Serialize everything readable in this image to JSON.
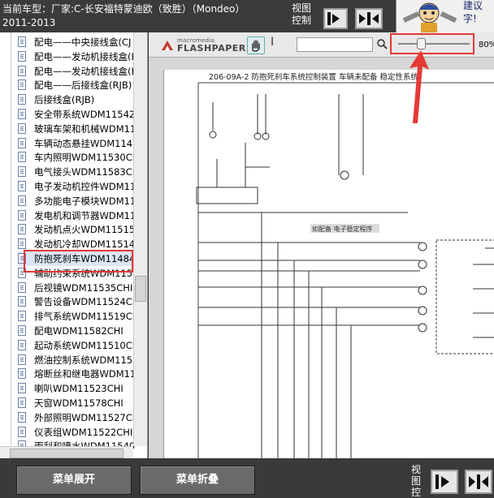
{
  "header": {
    "car_title": "当前车型：厂家:C-长安福特蒙迪欧（致胜）（Mondeo）",
    "year_range": "2011-2013",
    "view_control_label": "视图控制",
    "help_text_line1": "建议",
    "help_text_line2": "字!"
  },
  "sidebar": {
    "items": [
      {
        "label": "配电——中央接线盒(CJ"
      },
      {
        "label": "配电——发动机接线盒(E"
      },
      {
        "label": "配电——发动机接线盒(E"
      },
      {
        "label": "配电——后接线盒(RJB)"
      },
      {
        "label": "后接线盒(RJB)"
      },
      {
        "label": "安全带系统WDM11542"
      },
      {
        "label": "玻璃车架和机械WDM11"
      },
      {
        "label": "车辆动态悬挂WDM1148"
      },
      {
        "label": "车内照明WDM11530CH"
      },
      {
        "label": "电气接头WDM11583CH"
      },
      {
        "label": "电子发动机控件WDM11"
      },
      {
        "label": "多功能电子模块WDM11"
      },
      {
        "label": "发电机和调节器WDM11"
      },
      {
        "label": "发动机点火WDM11515"
      },
      {
        "label": "发动机冷却WDM11514"
      },
      {
        "label": "防抱死刹车WDM11484"
      },
      {
        "label": "辅助约束系统WDM1154"
      },
      {
        "label": "后视镜WDM11535CHI"
      },
      {
        "label": "警告设备WDM11524CH"
      },
      {
        "label": "排气系统WDM11519CH"
      },
      {
        "label": "配电WDM11582CHI"
      },
      {
        "label": "起动系统WDM11510CH"
      },
      {
        "label": "燃油控制系统WDM1151"
      },
      {
        "label": "熔断丝和继电器WDM11"
      },
      {
        "label": "喇叭WDM11523CHI"
      },
      {
        "label": "天窗WDM11578CHI"
      },
      {
        "label": "外部照明WDM11527CH"
      },
      {
        "label": "仪表组WDM11522CHI"
      },
      {
        "label": "雨刮和喷水WDM11540"
      }
    ],
    "selected_index": 15
  },
  "viewer": {
    "logo_small": "macromedia",
    "logo_big": "FLASHPAPER",
    "zoom_value": "80%",
    "zoom_level_fraction": 0.3,
    "doc_title": "206-09A-2 防抱死刹车系统控制装置 车辆未配备 稳定性系统",
    "doc_note": "如配备 电子稳定程序"
  },
  "bottom": {
    "expand_label": "菜单展开",
    "collapse_label": "菜单折叠",
    "view_control_label": "视图控"
  },
  "colors": {
    "background": "#3a3a3a",
    "annotation_red": "#e53935",
    "selected_row": "#dce6f5"
  },
  "icons": [
    "document-icon",
    "hand-tool-icon",
    "text-select-icon",
    "search-icon",
    "prev-page-icon",
    "fit-width-icon",
    "next-page-icon",
    "mechanic-mascot-icon"
  ]
}
